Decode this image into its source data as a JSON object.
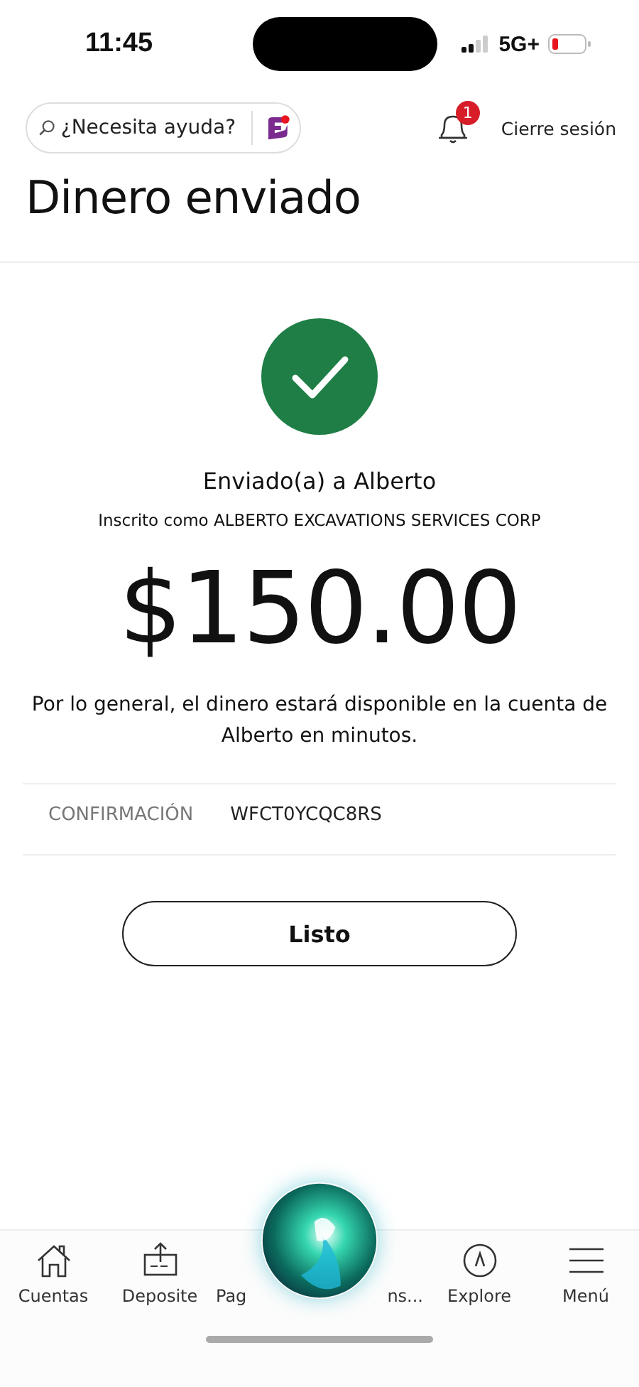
{
  "status_bar": {
    "time": "11:45",
    "network": "5G+"
  },
  "header": {
    "search": {
      "placeholder": "¿Necesita ayuda?"
    },
    "notifications": {
      "badge": "1"
    },
    "logout": "Cierre sesión"
  },
  "title": "Dinero enviado",
  "receipt": {
    "recipient_line": "Enviado(a) a Alberto",
    "enrolled_as": "Inscrito como ALBERTO EXCAVATIONS SERVICES CORP",
    "amount": "$150.00",
    "note": "Por lo general, el dinero estará disponible en la cuenta de Alberto en minutos.",
    "confirmation": {
      "label": "CONFIRMACIÓN",
      "value": "WFCT0YCQC8RS"
    },
    "done_button": "Listo"
  },
  "bottom_nav": [
    {
      "kind": "home",
      "label_parts": [
        "Cuentas"
      ]
    },
    {
      "kind": "deposit",
      "label_parts": [
        "Deposite"
      ]
    },
    {
      "kind": "covered",
      "label_parts": [
        "Pag",
        "ns..."
      ]
    },
    {
      "kind": "compass",
      "label_parts": [
        "Explore"
      ]
    },
    {
      "kind": "menu",
      "label_parts": [
        "Menú"
      ]
    }
  ]
}
